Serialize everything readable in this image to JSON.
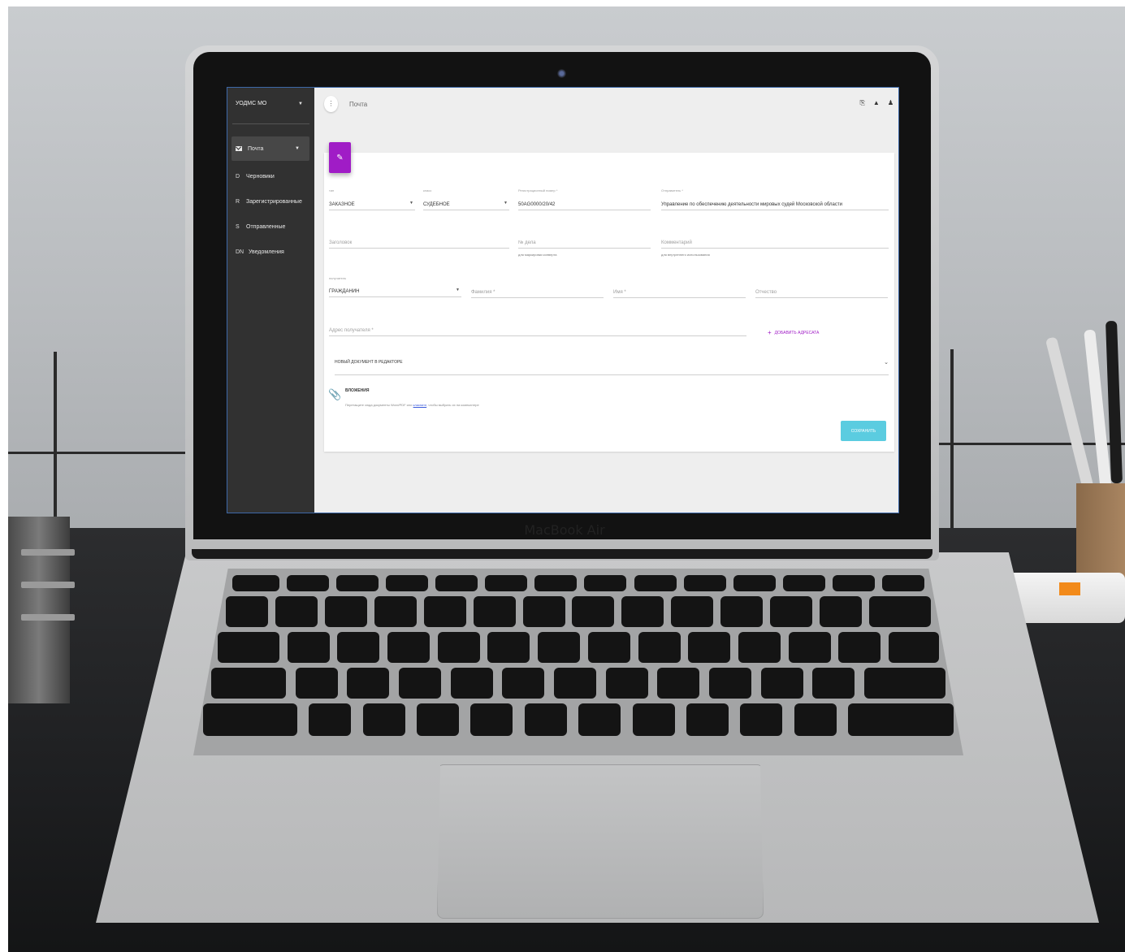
{
  "app": {
    "org": "УОДМС МО",
    "page_title": "Почта"
  },
  "sidebar": {
    "items": [
      {
        "mark": "",
        "label": "Почта",
        "active": true
      },
      {
        "mark": "D",
        "label": "Черновики"
      },
      {
        "mark": "R",
        "label": "Зарегистрированные"
      },
      {
        "mark": "S",
        "label": "Отправленные"
      },
      {
        "mark": "DN",
        "label": "Уведомления"
      }
    ]
  },
  "topbar": {
    "icons": [
      "print-icon",
      "bell-icon",
      "user-icon"
    ]
  },
  "form": {
    "type": {
      "label": "тип",
      "value": "ЗАКАЗНОЕ"
    },
    "class": {
      "label": "класс",
      "value": "СУДЕБНОЕ"
    },
    "reg_number": {
      "label": "Регистрационный номер *",
      "value": "50AG0000/20/42"
    },
    "sender": {
      "label": "Отправитель *",
      "value": "Управление по обеспечению деятельности мировых судей Московской области"
    },
    "subject": {
      "placeholder": "Заголовок"
    },
    "case_number": {
      "placeholder": "№ дела",
      "hint": "для маркировки конверта"
    },
    "comment": {
      "placeholder": "Комментарий",
      "hint": "для внутреннего использования"
    },
    "recipient": {
      "label": "получатель",
      "value": "ГРАЖДАНИН"
    },
    "last_name": {
      "placeholder": "Фамилия *"
    },
    "first_name": {
      "placeholder": "Имя *"
    },
    "patronymic": {
      "placeholder": "Отчество"
    },
    "address": {
      "placeholder": "Адрес получателя *"
    },
    "add_recipient": "ДОБАВИТЬ АДРЕСАТА",
    "editor_toggle": "НОВЫЙ ДОКУМЕНТ В РЕДАКТОРЕ",
    "attachments_title": "ВЛОЖЕНИЯ",
    "attachments_hint_before": "Перетащите сюда документы Word/PDF или",
    "attachments_hint_link": "кликните",
    "attachments_hint_after": "чтобы выбрать их на компьютере",
    "save": "СОХРАНИТЬ"
  },
  "device": {
    "brand": "MacBook Air"
  },
  "colors": {
    "accent": "#a01cc6",
    "save_button": "#5bcce0",
    "sidebar": "#313131"
  }
}
